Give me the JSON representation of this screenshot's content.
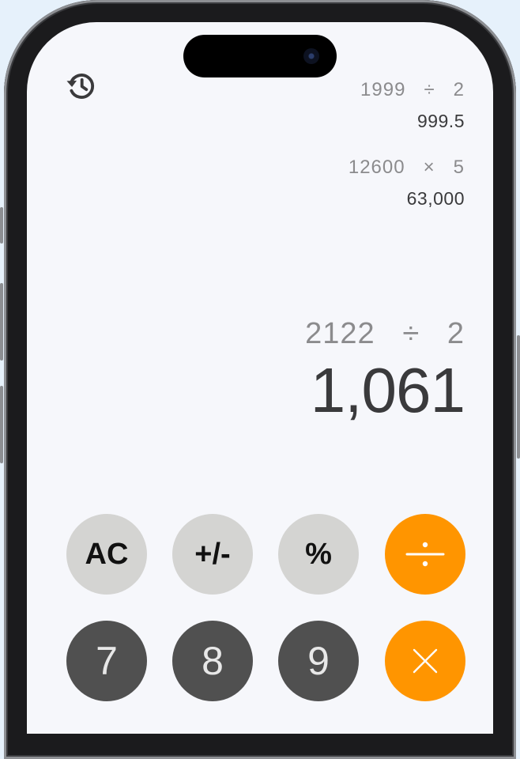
{
  "history_icon": "history-icon",
  "history": [
    {
      "operand1": "1999",
      "operator": "÷",
      "operand2": "2",
      "result": "999.5"
    },
    {
      "operand1": "12600",
      "operator": "×",
      "operand2": "5",
      "result": "63,000"
    }
  ],
  "current": {
    "operand1": "2122",
    "operator": "÷",
    "operand2": "2",
    "result": "1,061"
  },
  "keys": {
    "ac": "AC",
    "plus_minus": "+/-",
    "percent": "%",
    "divide_icon": "divide-icon",
    "seven": "7",
    "eight": "8",
    "nine": "9",
    "multiply_icon": "multiply-icon"
  },
  "colors": {
    "operator": "#ff9500",
    "function_key": "#d4d4d2",
    "number_key": "#505050",
    "background": "#f6f7fb"
  }
}
